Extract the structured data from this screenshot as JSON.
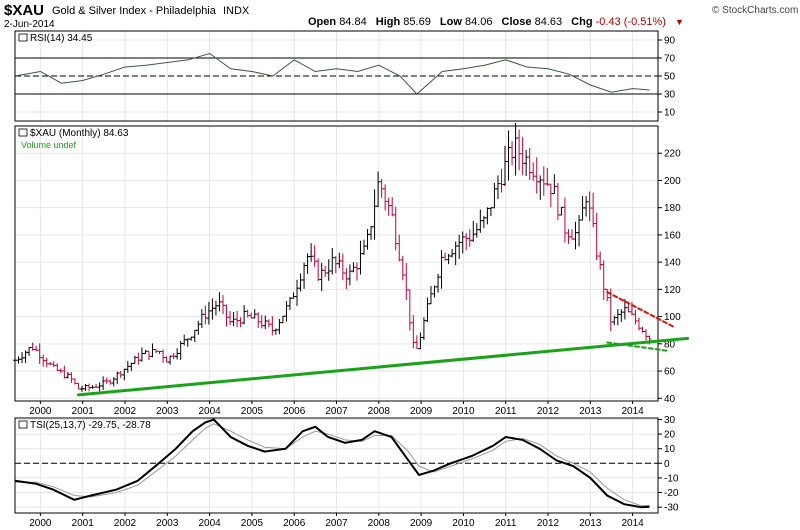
{
  "header": {
    "symbol": "$XAU",
    "description": "Gold & Silver Index - Philadelphia",
    "exchange": "INDX",
    "date": "2-Jun-2014",
    "open_label": "Open",
    "open": "84.84",
    "high_label": "High",
    "high": "85.69",
    "low_label": "Low",
    "low": "84.06",
    "close_label": "Close",
    "close": "84.63",
    "chg_label": "Chg",
    "chg": "-0.43 (-0.51%)",
    "chg_arrow": "▼",
    "brand": "© StockCharts.com"
  },
  "colors": {
    "price_up": "#000000",
    "price_down": "#c0003c",
    "trend_green": "#1aa31a",
    "dash_red": "#e01010",
    "dash_green": "#1aa31a",
    "rsi_line": "#3a5a3a",
    "grid": "#e6e6e6"
  },
  "chart_data": [
    {
      "type": "line",
      "panel": "RSI",
      "label": "RSI(14) 34.45",
      "ylim": [
        0,
        100
      ],
      "yticks": [
        10,
        30,
        50,
        70,
        90
      ],
      "reference_lines": [
        30,
        50,
        70
      ],
      "x": [
        1999.4,
        2000.0,
        2000.5,
        2001.0,
        2001.5,
        2002.0,
        2002.5,
        2003.0,
        2003.5,
        2004.0,
        2004.5,
        2005.0,
        2005.5,
        2006.0,
        2006.5,
        2007.0,
        2007.5,
        2008.0,
        2008.5,
        2008.9,
        2009.5,
        2010.0,
        2010.5,
        2011.0,
        2011.5,
        2012.0,
        2012.5,
        2013.0,
        2013.5,
        2014.0,
        2014.4
      ],
      "values": [
        50,
        55,
        42,
        45,
        52,
        60,
        62,
        65,
        68,
        75,
        58,
        55,
        50,
        68,
        55,
        58,
        55,
        62,
        50,
        30,
        55,
        58,
        62,
        68,
        60,
        58,
        52,
        40,
        32,
        36,
        34.45
      ]
    },
    {
      "type": "ohlc",
      "panel": "Price",
      "label": "$XAU (Monthly) 84.63",
      "volume_label": "Volume undef",
      "ylim": [
        38,
        240
      ],
      "yticks": [
        40,
        60,
        80,
        100,
        120,
        140,
        160,
        180,
        200,
        220
      ],
      "xlim": [
        1999.4,
        2014.6
      ],
      "x_ticks": [
        "2000",
        "2001",
        "2002",
        "2003",
        "2004",
        "2005",
        "2006",
        "2007",
        "2008",
        "2009",
        "2010",
        "2011",
        "2012",
        "2013",
        "2014"
      ],
      "close_path_x": [
        1999.4,
        1999.8,
        2000.0,
        2000.3,
        2000.7,
        2000.9,
        2001.2,
        2001.6,
        2002.0,
        2002.4,
        2002.8,
        2003.0,
        2003.5,
        2003.9,
        2004.2,
        2004.5,
        2004.8,
        2005.1,
        2005.5,
        2005.9,
        2006.3,
        2006.6,
        2006.9,
        2007.3,
        2007.7,
        2008.0,
        2008.3,
        2008.6,
        2008.85,
        2009.1,
        2009.5,
        2009.9,
        2010.2,
        2010.5,
        2010.9,
        2011.2,
        2011.5,
        2011.8,
        2012.1,
        2012.4,
        2012.7,
        2012.9,
        2013.2,
        2013.5,
        2013.8,
        2014.1,
        2014.4
      ],
      "close_path_y": [
        68,
        78,
        72,
        62,
        55,
        47,
        48,
        52,
        62,
        72,
        75,
        68,
        85,
        102,
        110,
        95,
        100,
        98,
        90,
        110,
        145,
        130,
        140,
        130,
        150,
        200,
        175,
        130,
        70,
        100,
        145,
        155,
        160,
        170,
        205,
        225,
        215,
        205,
        195,
        165,
        160,
        190,
        140,
        95,
        105,
        96,
        84.63
      ],
      "trendlines": [
        {
          "style": "solid-green",
          "x": [
            2000.9,
            2015.3
          ],
          "y": [
            42.5,
            84
          ]
        },
        {
          "style": "dashed-red",
          "x": [
            2013.4,
            2015.0
          ],
          "y": [
            118,
            92
          ]
        },
        {
          "style": "dashed-green",
          "x": [
            2013.4,
            2014.8
          ],
          "y": [
            81,
            75
          ]
        }
      ]
    },
    {
      "type": "line",
      "panel": "TSI",
      "label": "TSI(25,13,7) -29.75, -28.78",
      "ylim": [
        -34,
        31
      ],
      "yticks": [
        30,
        20,
        10,
        0,
        -10,
        -20,
        -30
      ],
      "reference_lines": [
        0
      ],
      "series": [
        {
          "x": [
            1999.4,
            1999.9,
            2000.3,
            2000.8,
            2001.2,
            2001.8,
            2002.3,
            2002.8,
            2003.2,
            2003.6,
            2003.9,
            2004.1,
            2004.5,
            2004.9,
            2005.3,
            2005.8,
            2006.2,
            2006.5,
            2006.8,
            2007.2,
            2007.6,
            2007.9,
            2008.3,
            2008.7,
            2008.95,
            2009.3,
            2009.7,
            2010.2,
            2010.7,
            2011.0,
            2011.4,
            2011.8,
            2012.2,
            2012.6,
            2013.0,
            2013.4,
            2013.8,
            2014.2,
            2014.4
          ],
          "values": [
            -12,
            -14,
            -18,
            -25,
            -22,
            -18,
            -12,
            0,
            10,
            22,
            28,
            30,
            18,
            12,
            8,
            10,
            22,
            25,
            18,
            14,
            16,
            22,
            18,
            2,
            -8,
            -5,
            0,
            5,
            12,
            18,
            16,
            10,
            2,
            -2,
            -10,
            -22,
            -28,
            -30,
            -29.75
          ]
        },
        {
          "x": [
            1999.4,
            1999.9,
            2000.3,
            2000.8,
            2001.2,
            2001.8,
            2002.3,
            2002.8,
            2003.2,
            2003.6,
            2003.9,
            2004.1,
            2004.5,
            2004.9,
            2005.3,
            2005.8,
            2006.2,
            2006.5,
            2006.8,
            2007.2,
            2007.6,
            2007.9,
            2008.3,
            2008.7,
            2008.95,
            2009.3,
            2009.7,
            2010.2,
            2010.7,
            2011.0,
            2011.4,
            2011.8,
            2012.2,
            2012.6,
            2013.0,
            2013.4,
            2013.8,
            2014.2,
            2014.4
          ],
          "values": [
            -13,
            -13,
            -16,
            -22,
            -23,
            -20,
            -15,
            -4,
            5,
            16,
            24,
            27,
            22,
            16,
            11,
            10,
            18,
            22,
            20,
            16,
            15,
            19,
            19,
            8,
            -2,
            -6,
            -2,
            3,
            9,
            15,
            17,
            13,
            5,
            0,
            -6,
            -17,
            -25,
            -29,
            -28.78
          ]
        }
      ]
    }
  ]
}
